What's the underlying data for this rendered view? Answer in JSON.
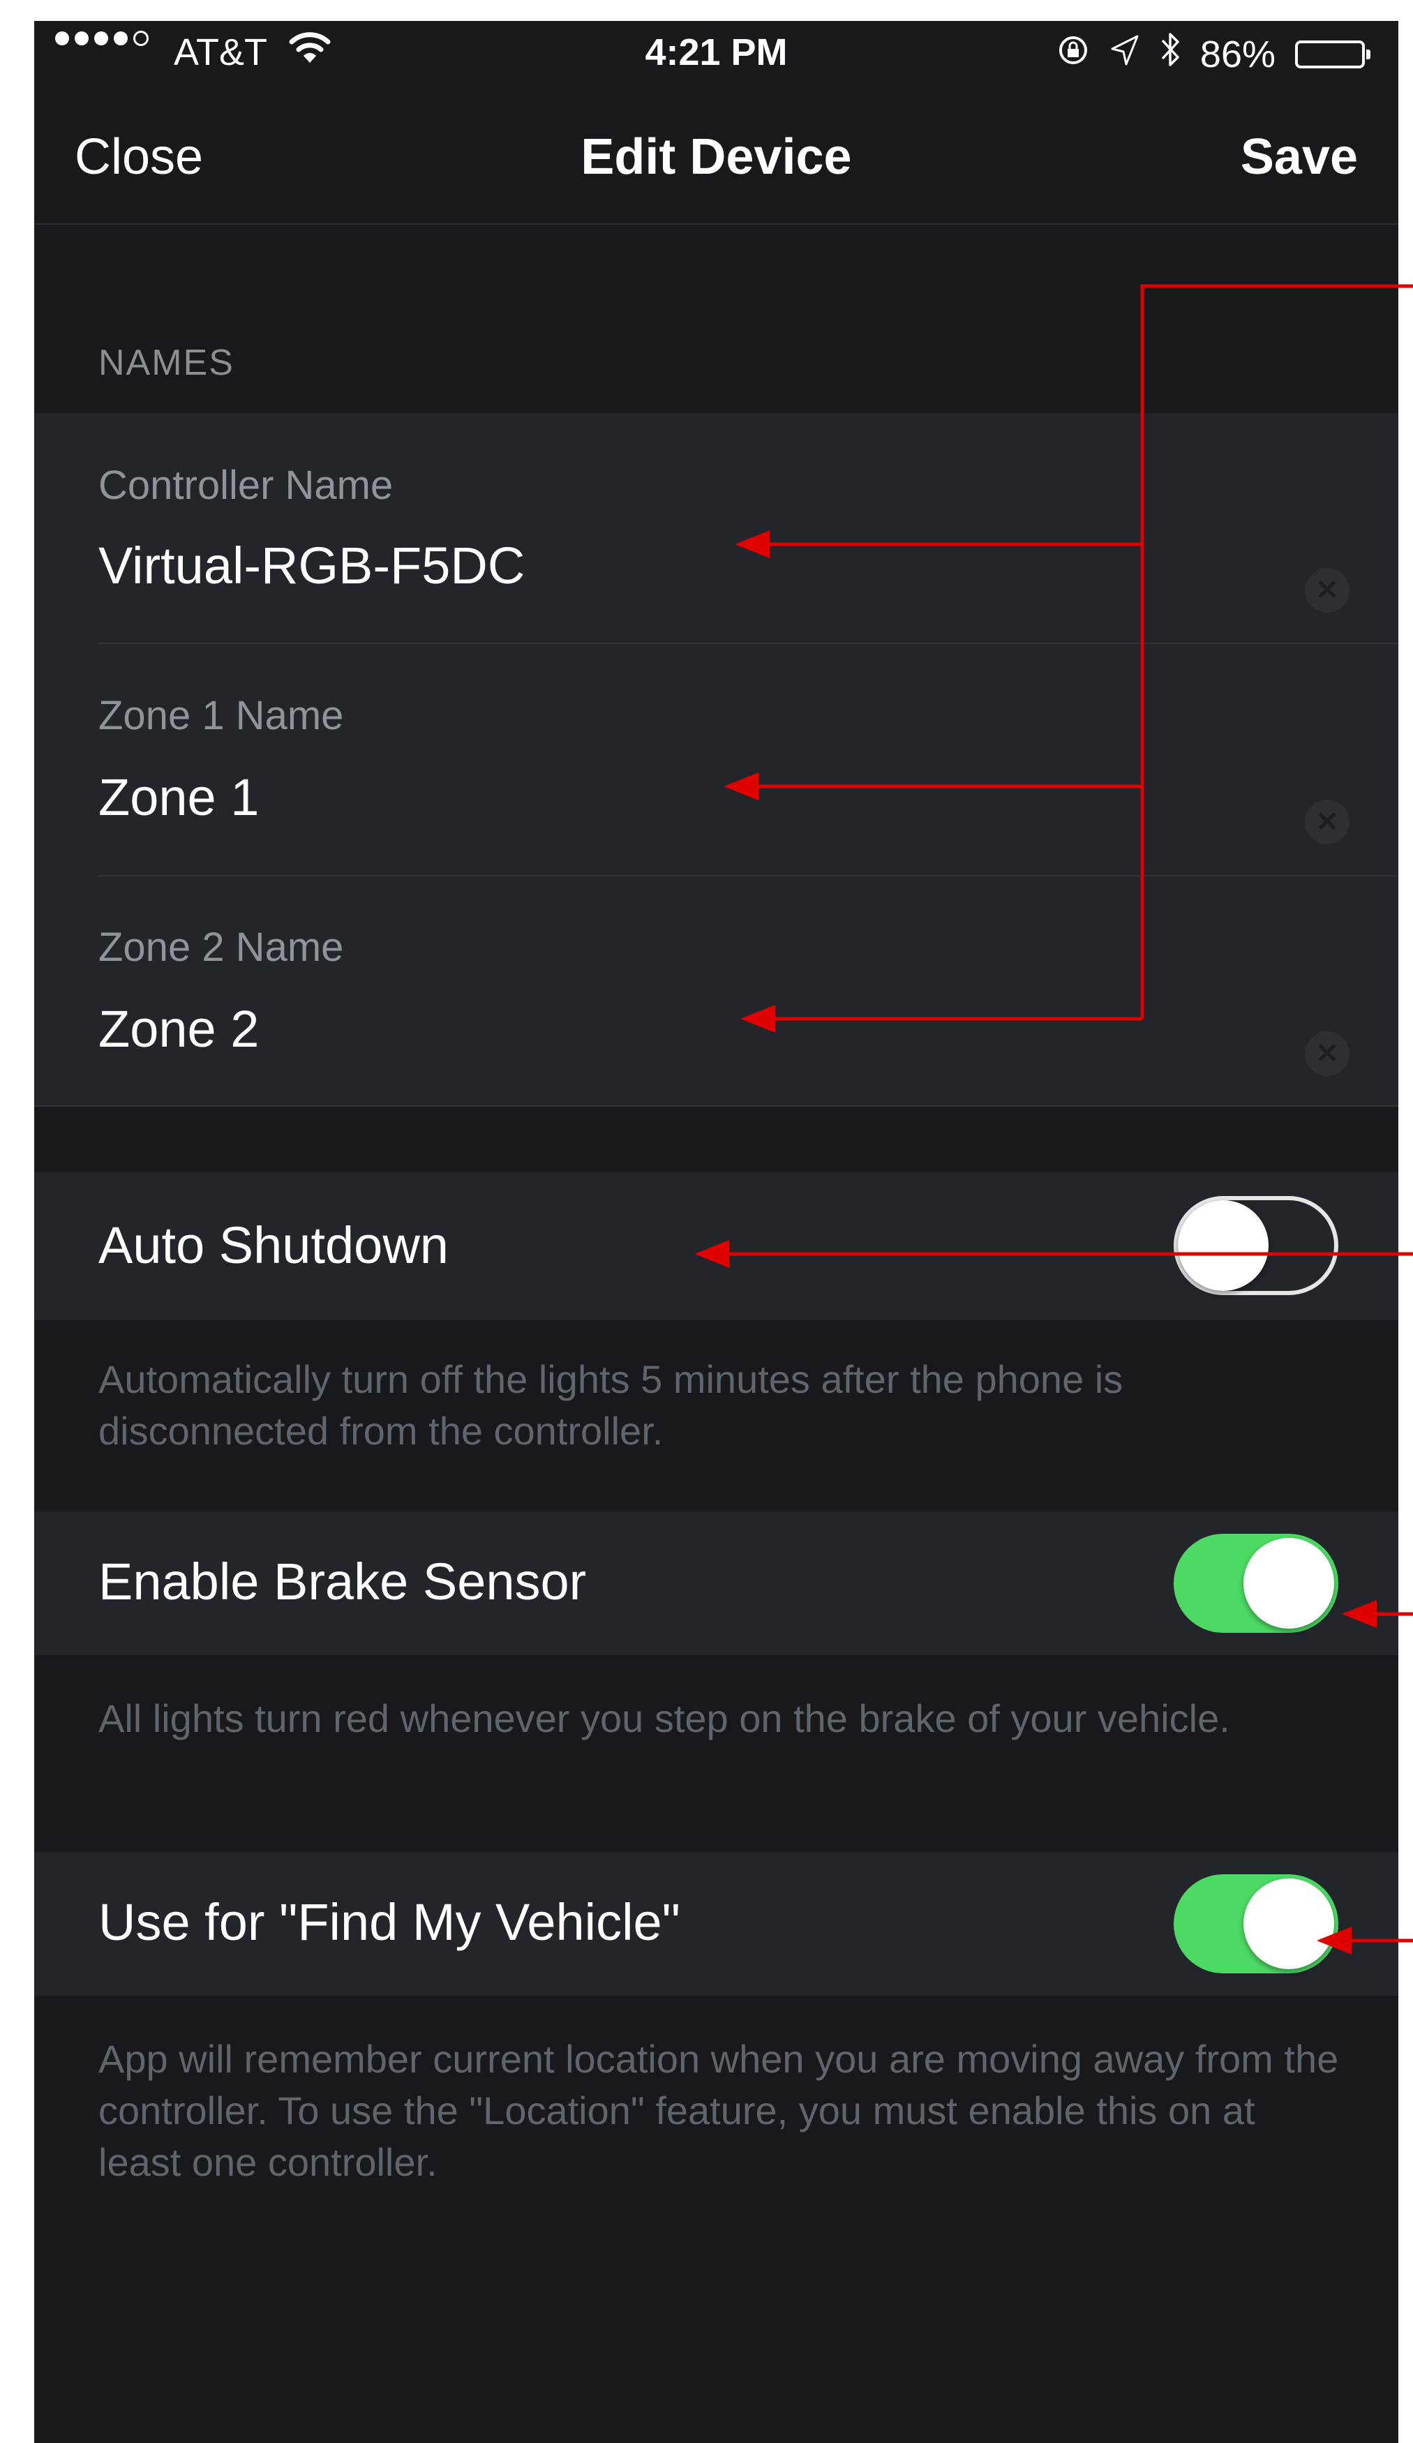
{
  "status_bar": {
    "carrier": "AT&T",
    "time": "4:21 PM",
    "battery_percent": "86%",
    "battery_level": 0.86
  },
  "nav": {
    "left": "Close",
    "title": "Edit Device",
    "right": "Save"
  },
  "names_section": {
    "header": "NAMES",
    "fields": [
      {
        "label": "Controller Name",
        "value": "Virtual-RGB-F5DC"
      },
      {
        "label": "Zone 1 Name",
        "value": "Zone 1"
      },
      {
        "label": "Zone 2 Name",
        "value": "Zone 2"
      }
    ]
  },
  "toggles": [
    {
      "label": "Auto Shutdown",
      "on": false,
      "description": "Automatically turn off the lights 5 minutes after the phone is disconnected from the controller."
    },
    {
      "label": "Enable Brake Sensor",
      "on": true,
      "description": "All lights turn red whenever you step on the brake of your vehicle."
    },
    {
      "label": "Use for \"Find My Vehicle\"",
      "on": true,
      "description": "App will remember current location when you are moving away from the controller.  To use the \"Location\" feature, you must enable this on at least one controller."
    }
  ],
  "colors": {
    "background": "#17191c",
    "row": "#22252a",
    "toggle_on": "#4cd964",
    "annotation": "#e00000"
  },
  "icons": [
    "signal-dots-icon",
    "wifi-icon",
    "orientation-lock-icon",
    "location-arrow-icon",
    "bluetooth-icon",
    "battery-icon",
    "clear-icon"
  ]
}
